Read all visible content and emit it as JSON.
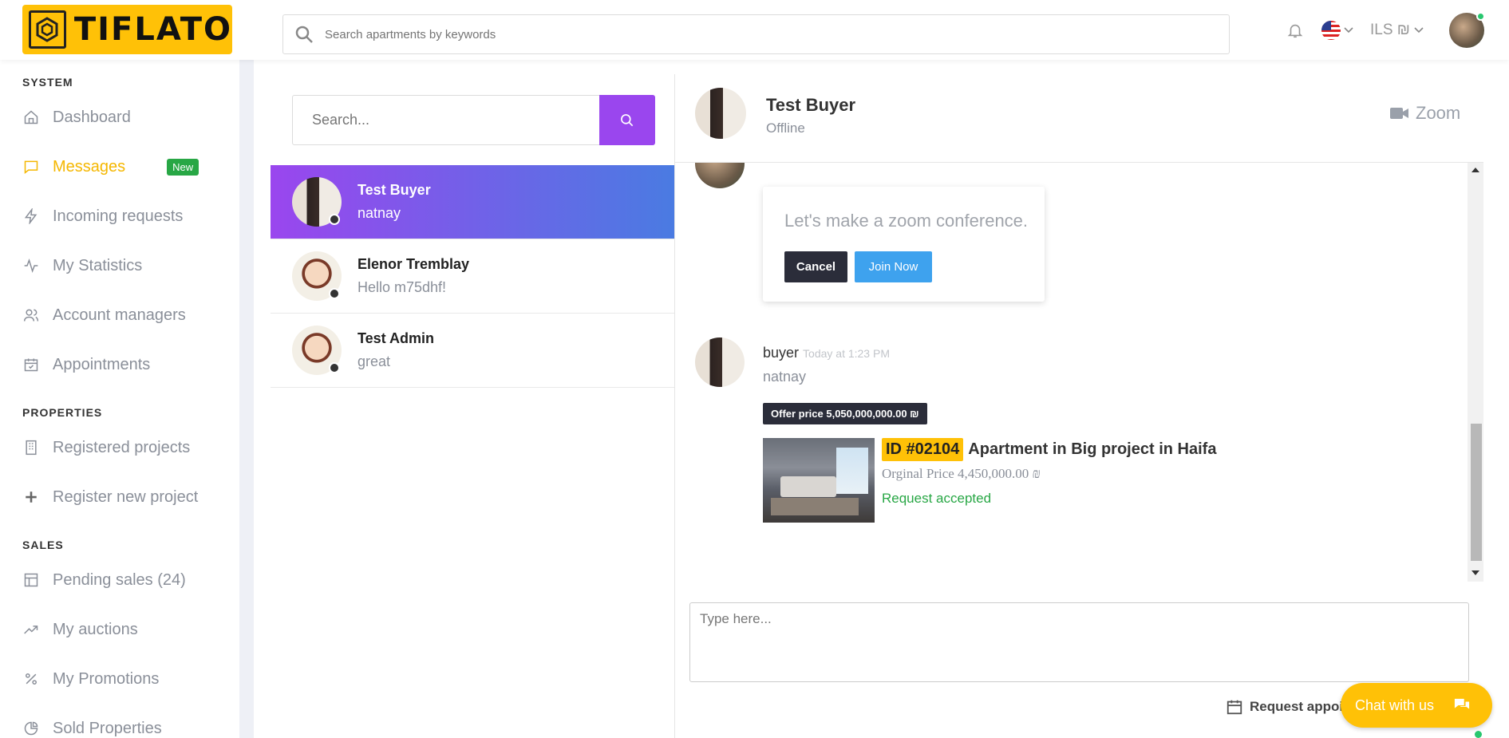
{
  "brand": {
    "logo_text": "TIFLATO"
  },
  "topbar": {
    "search_placeholder": "Search apartments by keywords",
    "currency": "ILS ₪"
  },
  "sidebar": {
    "sections": {
      "system": "SYSTEM",
      "properties": "PROPERTIES",
      "sales": "SALES"
    },
    "items": {
      "dashboard": "Dashboard",
      "messages": "Messages",
      "messages_badge": "New",
      "incoming": "Incoming requests",
      "statistics": "My Statistics",
      "managers": "Account managers",
      "appointments": "Appointments",
      "registered": "Registered projects",
      "register_new": "Register new project",
      "pending": "Pending sales (24)",
      "auctions": "My auctions",
      "promotions": "My Promotions",
      "sold": "Sold Properties"
    }
  },
  "conversations": {
    "search_placeholder": "Search...",
    "list": [
      {
        "name": "Test Buyer",
        "last": "natnay"
      },
      {
        "name": "Elenor Tremblay",
        "last": "Hello m75dhf!"
      },
      {
        "name": "Test Admin",
        "last": "great"
      }
    ]
  },
  "chat": {
    "name": "Test Buyer",
    "status": "Offline",
    "zoom_label": "Zoom",
    "zoom_card": {
      "text": "Let's make a zoom conference.",
      "cancel": "Cancel",
      "join": "Join Now"
    },
    "message": {
      "author": "buyer",
      "time": "Today at 1:23 PM",
      "text": "natnay",
      "offer": "Offer price 5,050,000,000.00 ₪",
      "listing_id": "ID #02104",
      "listing_title": "Apartment in Big project in Haifa",
      "original_price": "Orginal Price 4,450,000.00 ₪",
      "status": "Request accepted"
    },
    "input_placeholder": "Type here...",
    "request_label": "Request appoi",
    "chat_with_us": "Chat with us"
  },
  "colors": {
    "accent": "#ffc107",
    "purple": "#9a46ee",
    "blue": "#4a7be2",
    "green": "#28a745"
  }
}
